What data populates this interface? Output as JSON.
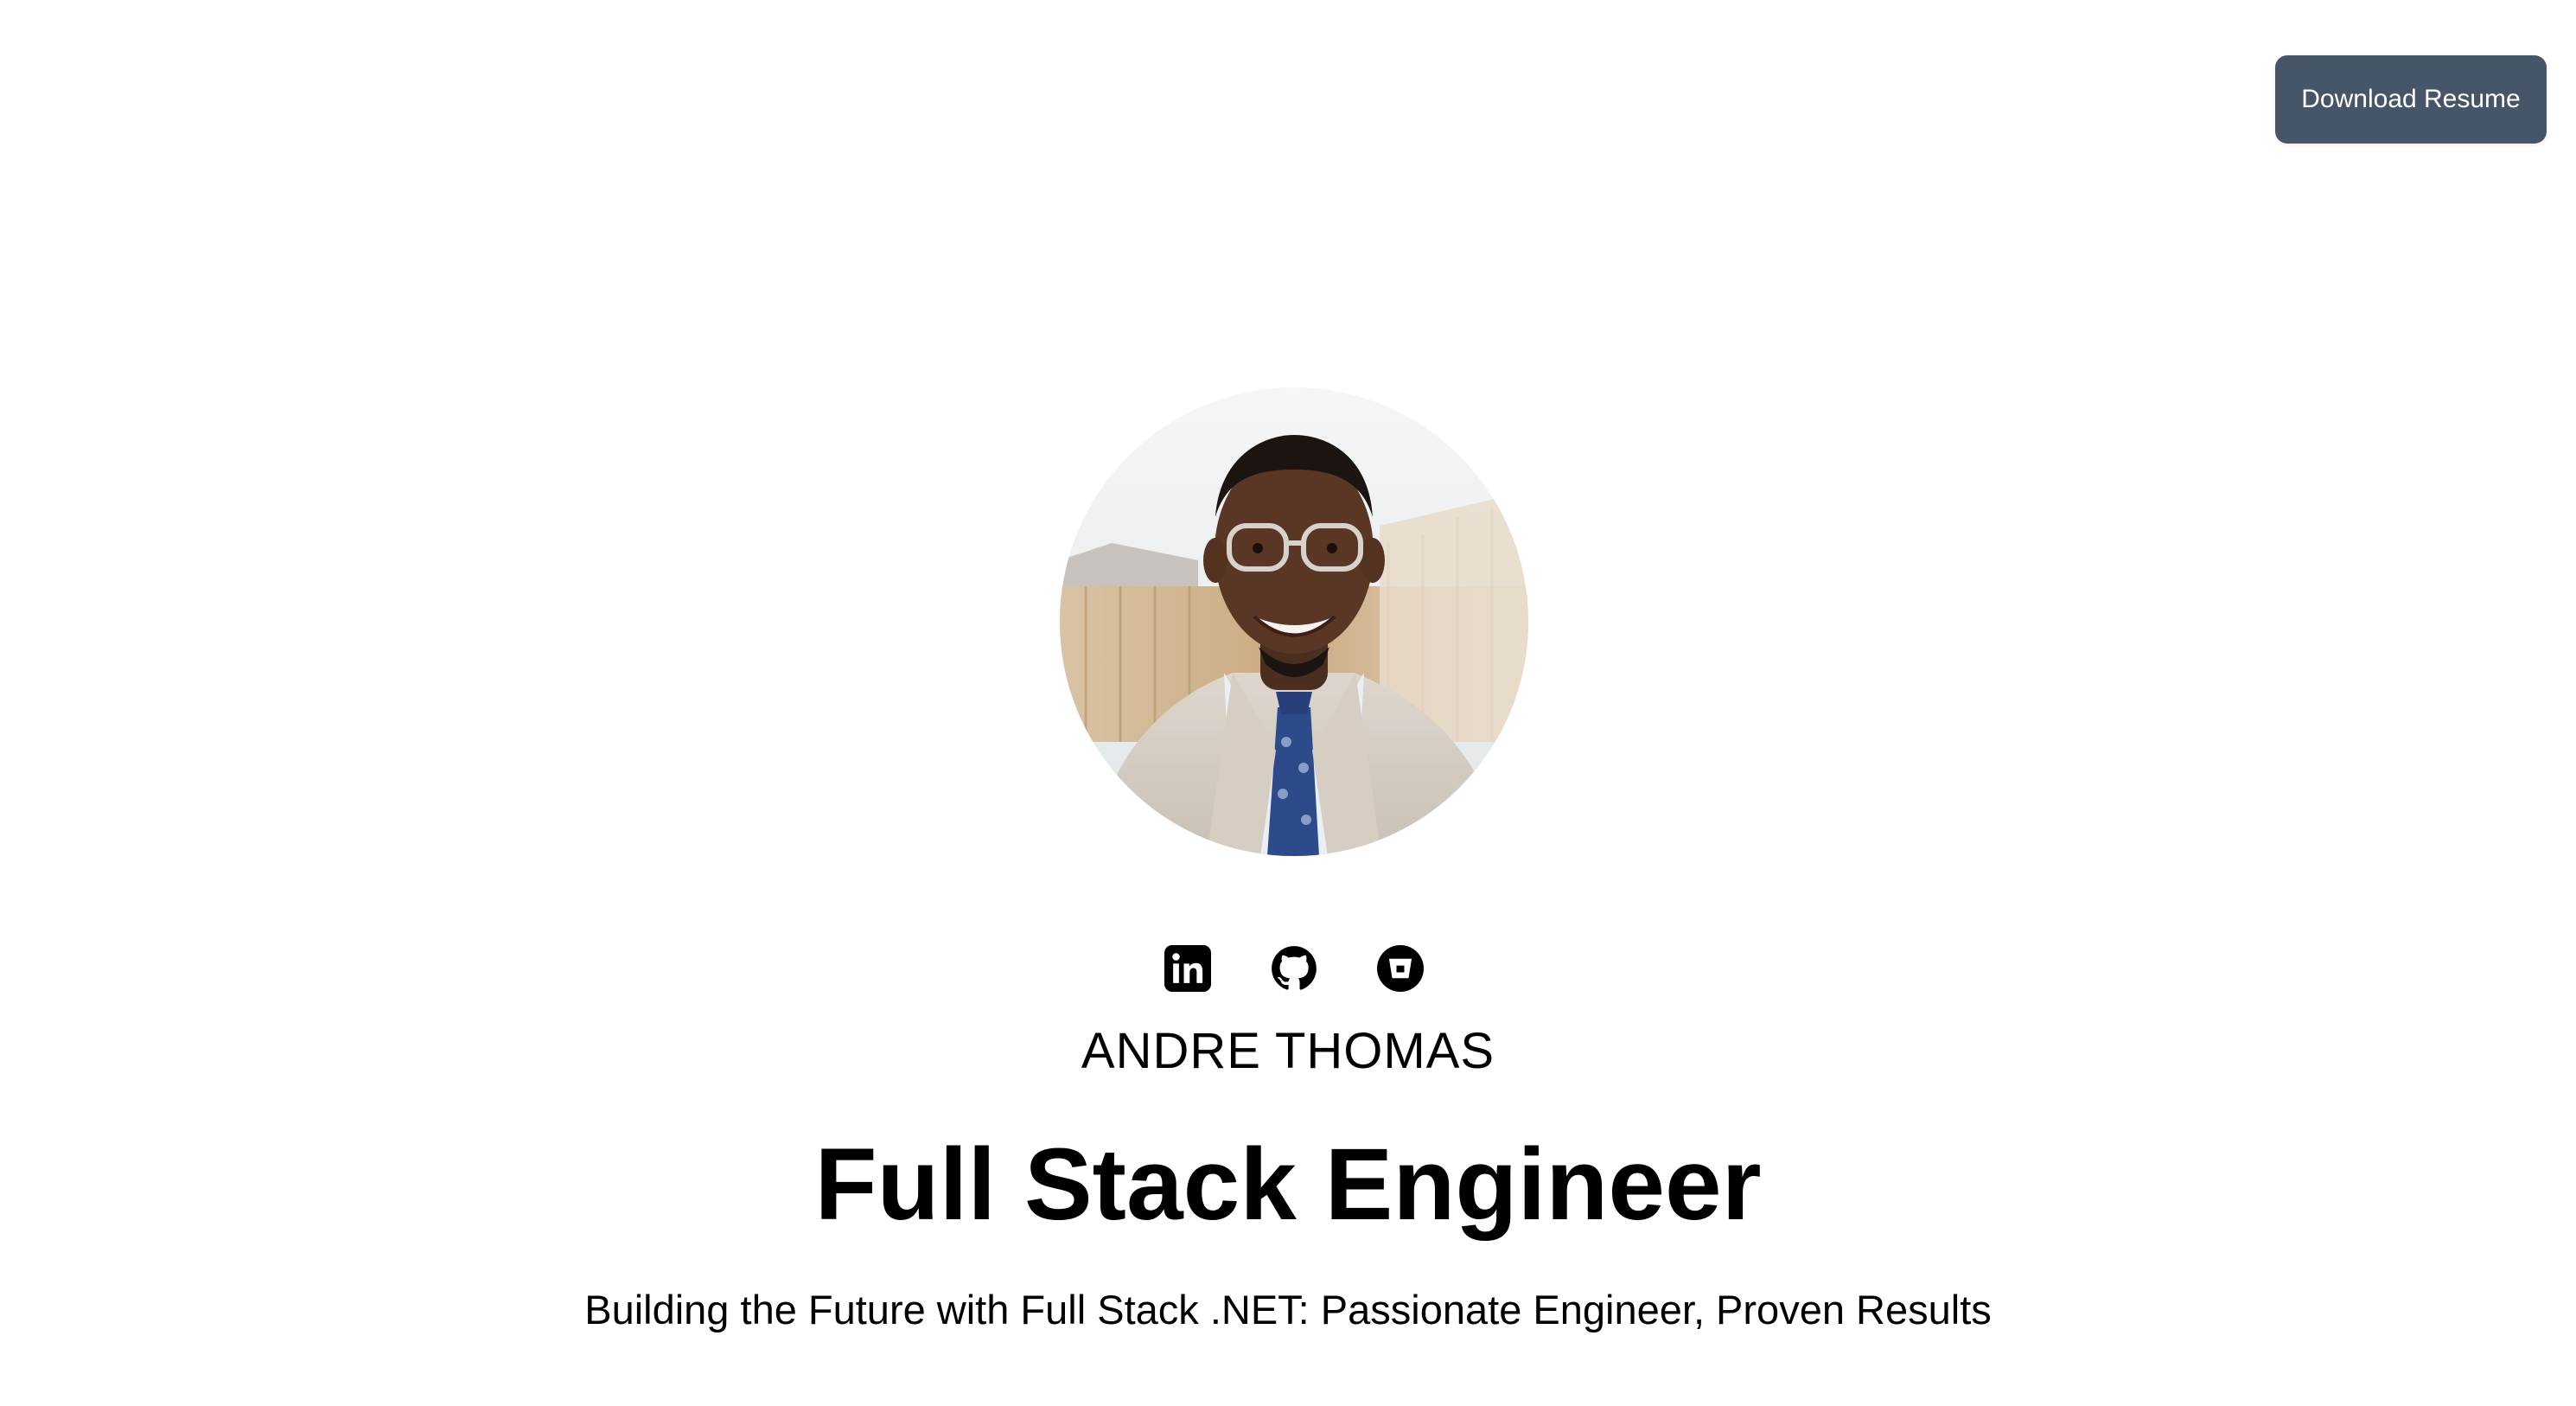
{
  "header": {
    "resume_button_label": "Download Resume"
  },
  "hero": {
    "social_links": [
      {
        "icon": "linkedin-icon"
      },
      {
        "icon": "github-icon"
      },
      {
        "icon": "bitbucket-icon"
      }
    ],
    "name": "ANDRE THOMAS",
    "title": "Full Stack Engineer",
    "tagline": "Building the Future with Full Stack .NET: Passionate Engineer, Proven Results"
  },
  "colors": {
    "button_bg": "#475569",
    "button_text": "#ffffff",
    "page_bg": "#ffffff",
    "text": "#000000"
  }
}
